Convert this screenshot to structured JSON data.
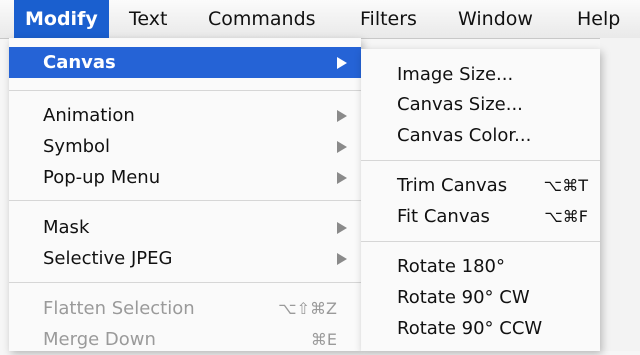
{
  "menubar": {
    "items": [
      {
        "label": "Modify"
      },
      {
        "label": "Text"
      },
      {
        "label": "Commands"
      },
      {
        "label": "Filters"
      },
      {
        "label": "Window"
      },
      {
        "label": "Help"
      }
    ]
  },
  "modify_menu": {
    "items": [
      {
        "label": "Canvas",
        "has_submenu": true,
        "state": "highlighted"
      },
      {
        "label": "Animation",
        "has_submenu": true
      },
      {
        "label": "Symbol",
        "has_submenu": true
      },
      {
        "label": "Pop-up Menu",
        "has_submenu": true
      },
      {
        "label": "Mask",
        "has_submenu": true
      },
      {
        "label": "Selective JPEG",
        "has_submenu": true
      },
      {
        "label": "Flatten Selection",
        "shortcut": "⌥⇧⌘Z",
        "state": "disabled"
      },
      {
        "label": "Merge Down",
        "shortcut": "⌘E",
        "state": "disabled"
      }
    ]
  },
  "canvas_submenu": {
    "items": [
      {
        "label": "Image Size..."
      },
      {
        "label": "Canvas Size..."
      },
      {
        "label": "Canvas Color..."
      },
      {
        "label": "Trim Canvas",
        "shortcut": "⌥⌘T"
      },
      {
        "label": "Fit Canvas",
        "shortcut": "⌥⌘F"
      },
      {
        "label": "Rotate 180°"
      },
      {
        "label": "Rotate 90° CW"
      },
      {
        "label": "Rotate 90° CCW"
      }
    ]
  },
  "colors": {
    "highlight": "#2563d6",
    "menubar_active": "#1a5fcf",
    "disabled_text": "#9a9a9a"
  },
  "icons": {
    "submenu_indicator": "chevron-right-icon"
  }
}
